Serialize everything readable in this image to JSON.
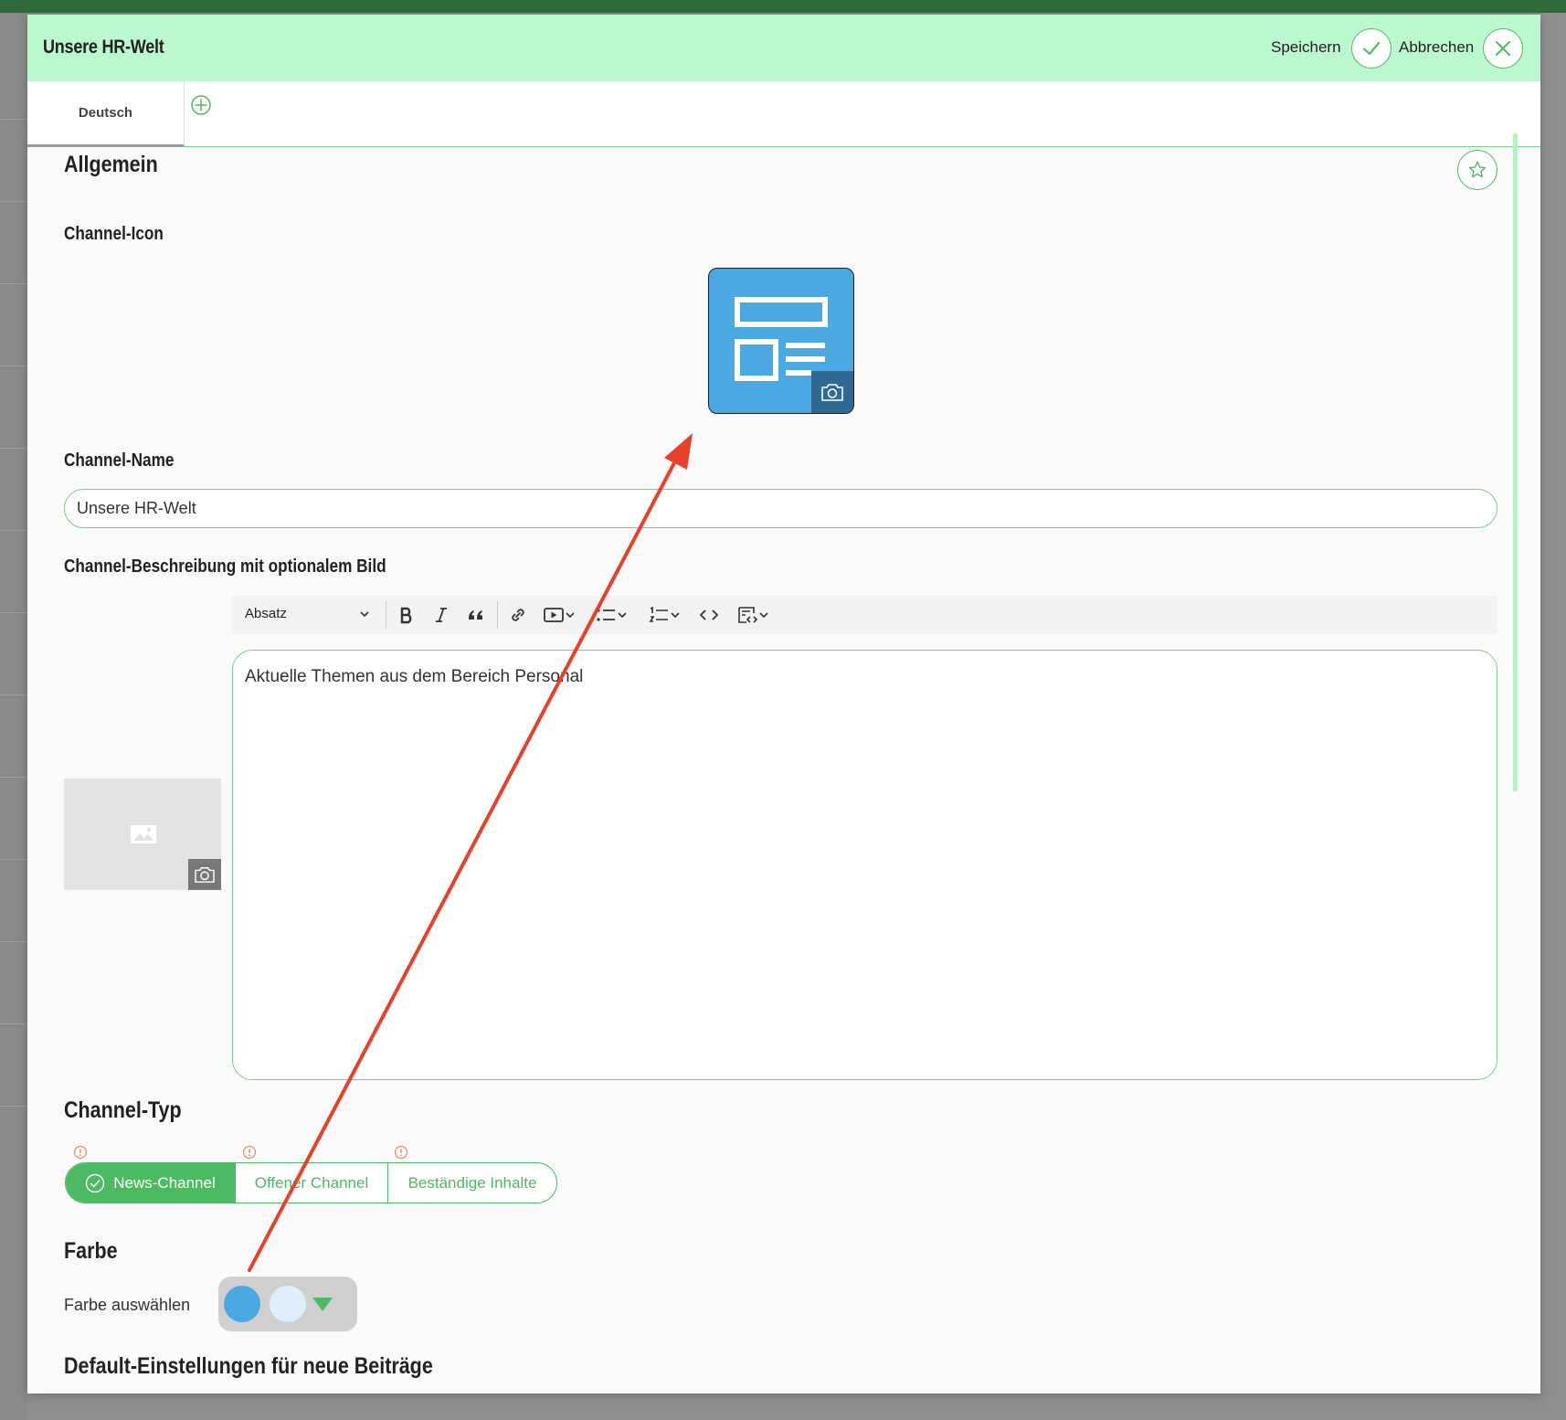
{
  "window": {
    "title": "Unsere HR-Welt",
    "save_label": "Speichern",
    "cancel_label": "Abbrechen"
  },
  "tabs": [
    {
      "label": "Deutsch",
      "active": true
    }
  ],
  "section": {
    "title": "Allgemein"
  },
  "fields": {
    "icon_label": "Channel-Icon",
    "name_label": "Channel-Name",
    "name_value": "Unsere HR-Welt",
    "description_label": "Channel-Beschreibung mit optionalem Bild",
    "description_value": "Aktuelle Themen aus dem Bereich Personal",
    "type_label": "Channel-Typ",
    "color_heading": "Farbe",
    "color_label": "Farbe auswählen",
    "defaults_heading": "Default-Einstellungen für neue Beiträge"
  },
  "toolbar": {
    "paragraph_select": "Absatz"
  },
  "channel_types": [
    {
      "label": "News-Channel",
      "active": true
    },
    {
      "label": "Offener Channel",
      "active": false
    },
    {
      "label": "Beständige Inhalte",
      "active": false
    }
  ],
  "colors": {
    "primary": "#4aa9e3",
    "secondary": "#ddeefa",
    "accent": "#4cba63",
    "header_bg": "#bbf7cf",
    "annotation_arrow": "#e8412a"
  }
}
